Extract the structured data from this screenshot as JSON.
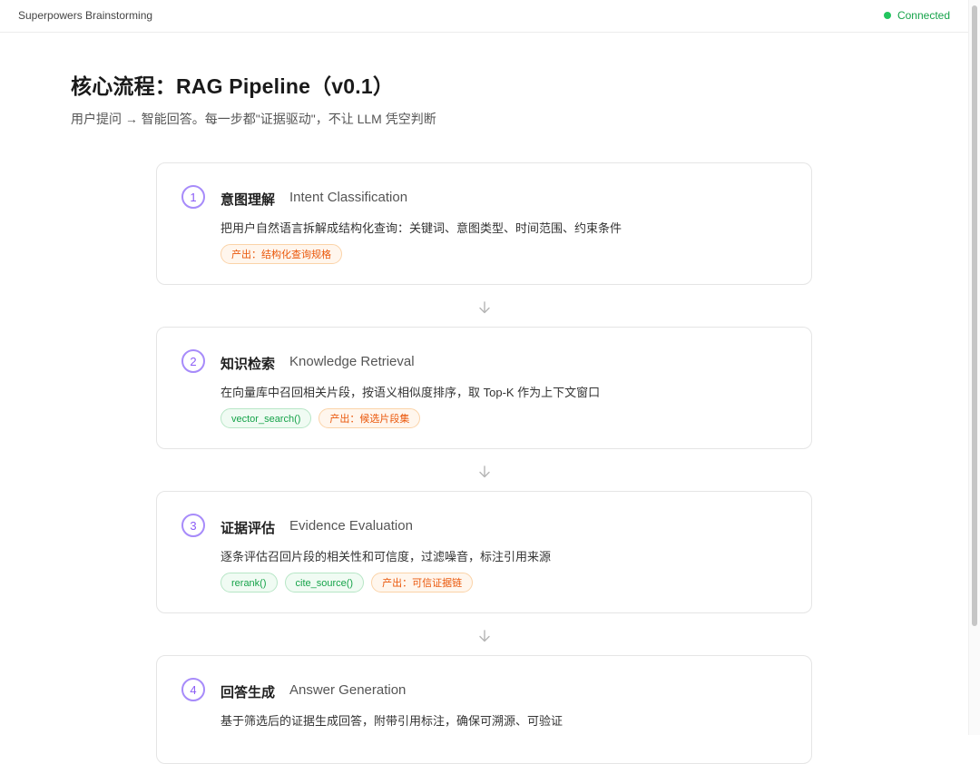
{
  "app": {
    "title": "Superpowers Brainstorming",
    "status": "Connected"
  },
  "colors": {
    "accent": "#8b5cf6",
    "connected": "#22c55e",
    "func_tag": "#16a34a",
    "output_tag": "#ea580c"
  },
  "page": {
    "title": "核心流程：RAG Pipeline（v0.1）",
    "subtitle": "用户提问 → 智能回答。每一步都\"证据驱动\"，不让 LLM 凭空判断"
  },
  "steps": [
    {
      "num": "1",
      "title": "意图理解",
      "en": "Intent Classification",
      "desc": "把用户自然语言拆解成结构化查询：关键词、意图类型、时间范围、约束条件",
      "tags": [
        {
          "text": "产出：结构化查询规格",
          "kind": "out"
        }
      ]
    },
    {
      "num": "2",
      "title": "知识检索",
      "en": "Knowledge Retrieval",
      "desc": "在向量库中召回相关片段，按语义相似度排序，取 Top-K 作为上下文窗口",
      "tags": [
        {
          "text": "vector_search()",
          "kind": "func"
        },
        {
          "text": "产出：候选片段集",
          "kind": "out"
        }
      ]
    },
    {
      "num": "3",
      "title": "证据评估",
      "en": "Evidence Evaluation",
      "desc": "逐条评估召回片段的相关性和可信度，过滤噪音，标注引用来源",
      "tags": [
        {
          "text": "rerank()",
          "kind": "func"
        },
        {
          "text": "cite_source()",
          "kind": "func"
        },
        {
          "text": "产出：可信证据链",
          "kind": "out"
        }
      ]
    },
    {
      "num": "4",
      "title": "回答生成",
      "en": "Answer Generation",
      "desc": "基于筛选后的证据生成回答，附带引用标注，确保可溯源、可验证",
      "tags": []
    }
  ],
  "icons": {
    "flow_arrow": "arrow-down-icon",
    "status": "status-dot-icon"
  }
}
